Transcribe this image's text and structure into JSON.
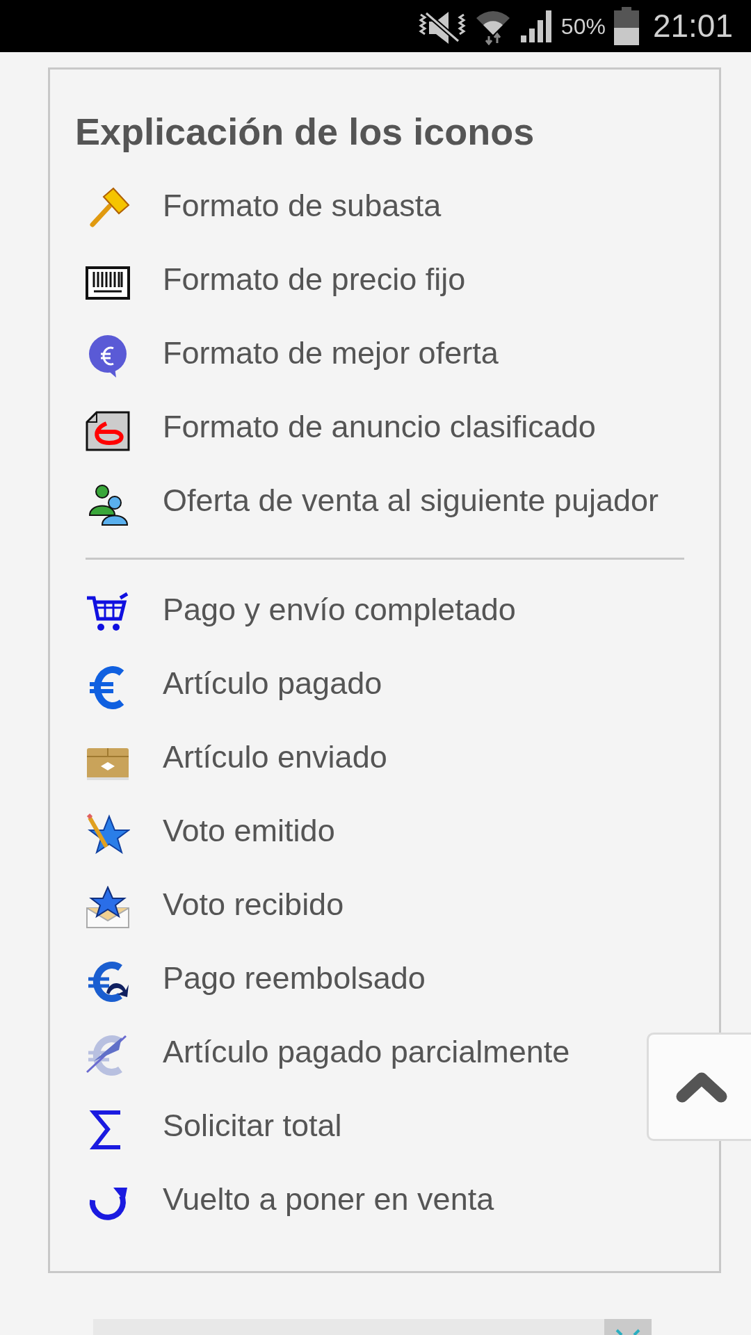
{
  "status_bar": {
    "battery_percent": "50%",
    "time": "21:01"
  },
  "legend": {
    "title": "Explicación de los iconos",
    "groups": [
      {
        "items": [
          {
            "label": "Formato de subasta"
          },
          {
            "label": "Formato de precio fijo"
          },
          {
            "label": "Formato de mejor oferta"
          },
          {
            "label": "Formato de anuncio clasificado"
          },
          {
            "label": "Oferta de venta al siguiente pujador"
          }
        ]
      },
      {
        "items": [
          {
            "label": "Pago y envío completado"
          },
          {
            "label": "Artículo pagado"
          },
          {
            "label": "Artículo enviado"
          },
          {
            "label": "Voto emitido"
          },
          {
            "label": "Voto recibido"
          },
          {
            "label": "Pago reembolsado"
          },
          {
            "label": "Artículo pagado parcialmente"
          },
          {
            "label": "Solicitar total"
          },
          {
            "label": "Vuelto a poner en venta"
          }
        ]
      }
    ]
  }
}
